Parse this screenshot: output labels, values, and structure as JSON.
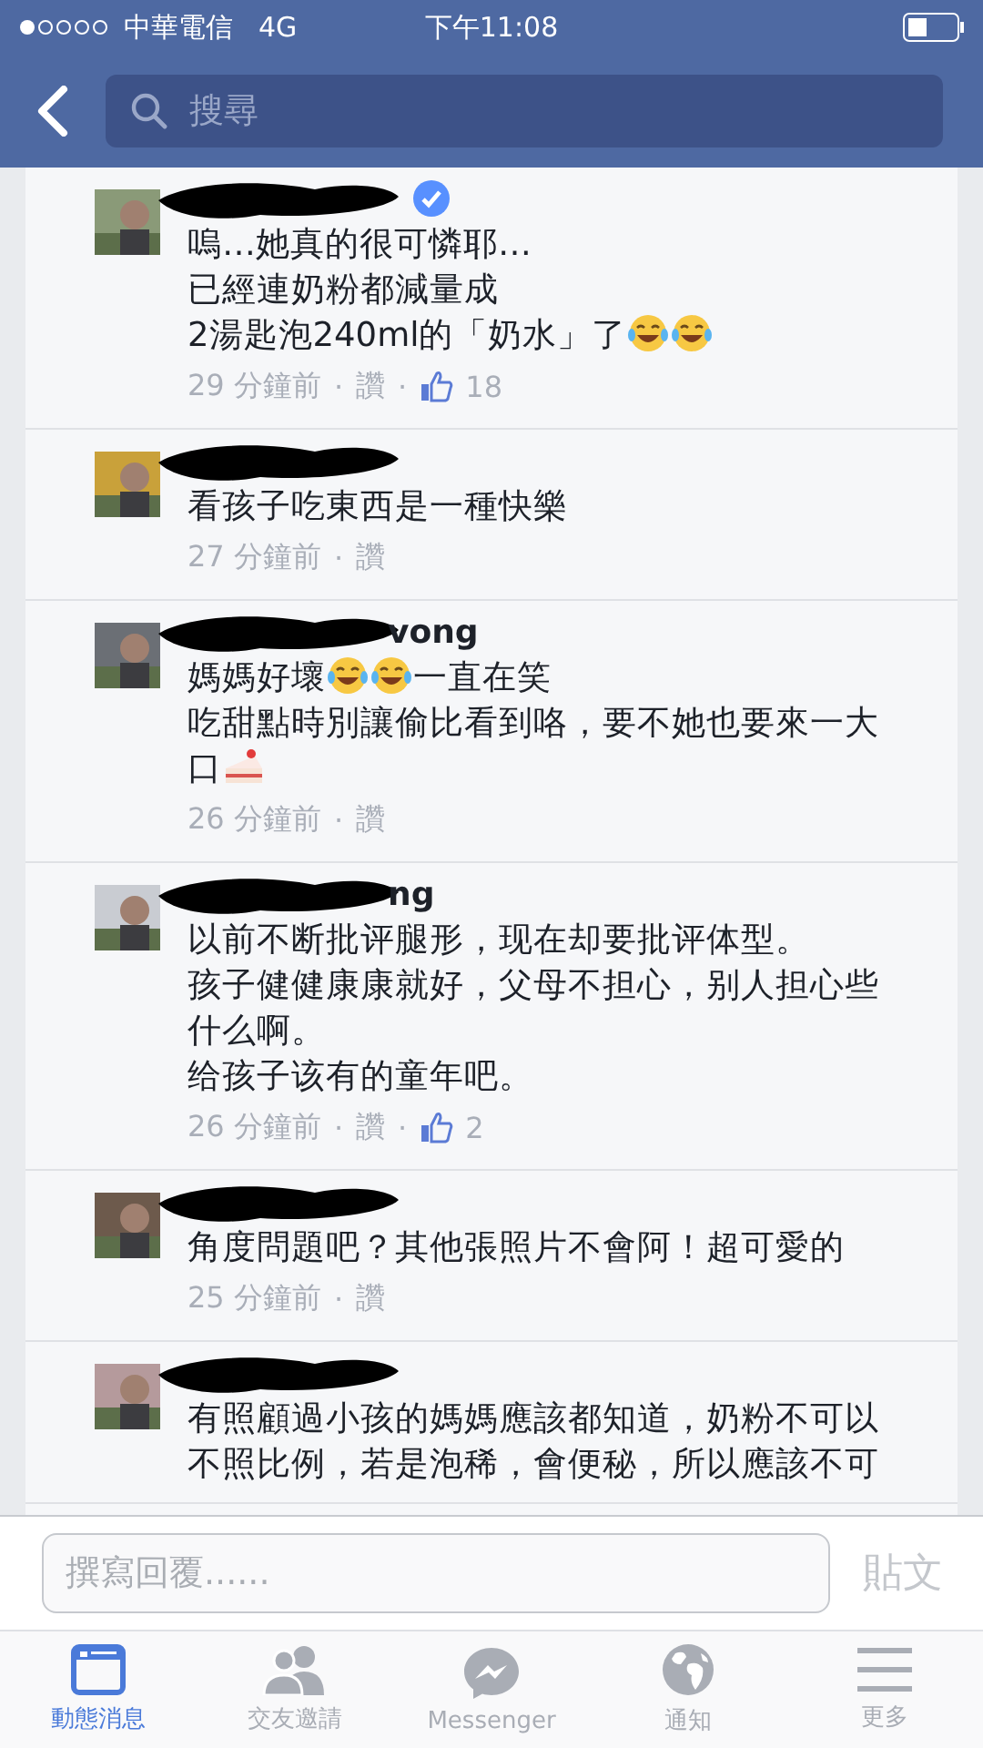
{
  "status_bar": {
    "carrier": "中華電信",
    "network": "4G",
    "time": "下午11:08"
  },
  "nav": {
    "search": {
      "placeholder": "搜尋"
    }
  },
  "comments": [
    {
      "verified": true,
      "redacted": true,
      "lines": [
        [
          {
            "kind": "text",
            "text": "嗚…她真的很可憐耶…"
          }
        ],
        [
          {
            "kind": "text",
            "text": "已經連奶粉都減量成"
          }
        ],
        [
          {
            "kind": "text",
            "text": "2湯匙泡240ml的「奶水」了"
          },
          {
            "kind": "laugh-emoji"
          },
          {
            "kind": "laugh-emoji"
          }
        ]
      ],
      "meta": [
        {
          "kind": "time",
          "text": "29 分鐘前"
        },
        {
          "kind": "sep",
          "text": "·"
        },
        {
          "kind": "link",
          "text": "讚"
        },
        {
          "kind": "sep",
          "text": "·"
        },
        {
          "kind": "likes",
          "text": "18"
        }
      ]
    },
    {
      "verified": false,
      "redacted": true,
      "lines": [
        [
          {
            "kind": "text",
            "text": "看孩子吃東西是一種快樂"
          }
        ]
      ],
      "meta": [
        {
          "kind": "time",
          "text": "27 分鐘前"
        },
        {
          "kind": "sep",
          "text": "·"
        },
        {
          "kind": "link",
          "text": "讚"
        }
      ]
    },
    {
      "name": "vong",
      "verified": false,
      "redacted": true,
      "lines": [
        [
          {
            "kind": "text",
            "text": "媽媽好壞"
          },
          {
            "kind": "laugh-emoji"
          },
          {
            "kind": "laugh-emoji"
          },
          {
            "kind": "text",
            "text": "一直在笑"
          }
        ],
        [
          {
            "kind": "text",
            "text": "吃甜點時別讓偷比看到咯，要不她也要來一大"
          }
        ],
        [
          {
            "kind": "text",
            "text": "口"
          },
          {
            "kind": "cake-emoji"
          }
        ]
      ],
      "meta": [
        {
          "kind": "time",
          "text": "26 分鐘前"
        },
        {
          "kind": "sep",
          "text": "·"
        },
        {
          "kind": "link",
          "text": "讚"
        }
      ]
    },
    {
      "name": "ng",
      "verified": false,
      "redacted": true,
      "lines": [
        [
          {
            "kind": "text",
            "text": "以前不断批评腿形，现在却要批评体型。"
          }
        ],
        [
          {
            "kind": "text",
            "text": "孩子健健康康就好，父母不担心，别人担心些什么啊。"
          }
        ],
        [
          {
            "kind": "text",
            "text": "给孩子该有的童年吧。"
          }
        ]
      ],
      "meta": [
        {
          "kind": "time",
          "text": "26 分鐘前"
        },
        {
          "kind": "sep",
          "text": "·"
        },
        {
          "kind": "link",
          "text": "讚"
        },
        {
          "kind": "sep",
          "text": "·"
        },
        {
          "kind": "likes",
          "text": "2"
        }
      ]
    },
    {
      "verified": false,
      "redacted": true,
      "lines": [
        [
          {
            "kind": "text",
            "text": "角度問題吧？其他張照片不會阿！超可愛的"
          }
        ]
      ],
      "meta": [
        {
          "kind": "time",
          "text": "25 分鐘前"
        },
        {
          "kind": "sep",
          "text": "·"
        },
        {
          "kind": "link",
          "text": "讚"
        }
      ]
    },
    {
      "verified": false,
      "redacted": true,
      "lines": [
        [
          {
            "kind": "text",
            "text": "有照顧過小孩的媽媽應該都知道，奶粉不可以"
          }
        ],
        [
          {
            "kind": "text",
            "text": "不照比例，若是泡稀，會便秘，所以應該不可"
          }
        ]
      ]
    }
  ],
  "reply": {
    "placeholder": "撰寫回覆......",
    "post_button": {
      "label": "貼文",
      "disabled": true
    }
  },
  "tabs": [
    {
      "kind": "feed",
      "label": "動態消息",
      "selected": true
    },
    {
      "kind": "friends",
      "label": "交友邀請",
      "selected": false
    },
    {
      "kind": "messenger",
      "label": "Messenger",
      "selected": false
    },
    {
      "kind": "globe",
      "label": "通知",
      "selected": false
    },
    {
      "kind": "more",
      "label": "更多",
      "selected": false
    }
  ]
}
